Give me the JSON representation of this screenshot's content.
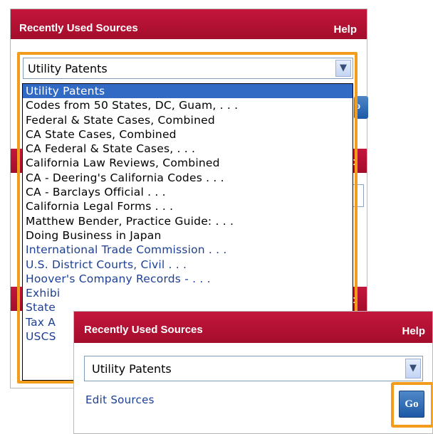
{
  "colors": {
    "header_red": "#b5102f",
    "highlight_orange": "#f39b1b",
    "selection_blue": "#316ac5",
    "link_blue": "#1c3f94",
    "button_blue": "#2a66ae"
  },
  "back_panel": {
    "title": "Recently Used Sources",
    "help": "Help",
    "selected_source": "Utility Patents",
    "peek_go_label": "o",
    "peek_help_letter": "p"
  },
  "dropdown": {
    "options": [
      "Utility Patents",
      "Codes from 50 States, DC, Guam, . . .",
      "Federal & State Cases, Combined",
      "CA State Cases, Combined",
      "CA Federal & State Cases, . . .",
      "California Law Reviews, Combined",
      "CA - Deering's California Codes . . .",
      "CA - Barclays Official . . .",
      "California Legal Forms . . .",
      "Matthew Bender, Practice Guide: . . .",
      "Doing Business in Japan",
      "International Trade Commission . . .",
      "U.S. District Courts, Civil . . .",
      "Hoover's Company Records - . . .",
      "Exhibi",
      "State",
      "Tax A",
      "USCS"
    ]
  },
  "front_panel": {
    "title": "Recently Used Sources",
    "help": "Help",
    "selected_source": "Utility Patents",
    "edit_sources": "Edit Sources",
    "go": "Go"
  }
}
